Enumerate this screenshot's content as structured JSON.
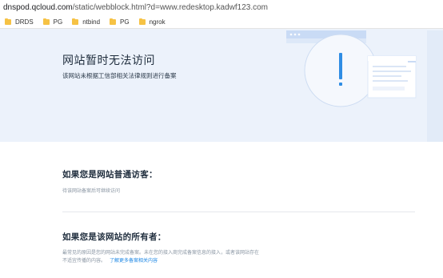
{
  "browser": {
    "url_host": "dnspod.qcloud.com",
    "url_path": "/static/webblock.html?d=www.redesktop.kadwf123.com",
    "bookmarks": [
      {
        "label": "DRDS"
      },
      {
        "label": "PG"
      },
      {
        "label": "ntbind"
      },
      {
        "label": "PG"
      },
      {
        "label": "ngrok"
      }
    ]
  },
  "hero": {
    "title": "网站暂时无法访问",
    "subtitle": "该网站未根据工信部相关法律规则进行备案",
    "illustration_icon": "exclamation-icon"
  },
  "visitor": {
    "title": "如果您是网站普通访客：",
    "text": "待该网站备案后可继续访问"
  },
  "owner": {
    "title": "如果您是该网站的所有者：",
    "text_line1": "最常见的原因是您的网站未完成备案。未在您的接入商完成备案信息的接入，或者该网站存在",
    "text_line2": "不适宜传播的内容。",
    "link_label": "了解更多备案相关内容"
  },
  "colors": {
    "hero_bg": "#ecf2fb",
    "accent_blue": "#1e88e5",
    "folder_yellow": "#f6c244"
  }
}
